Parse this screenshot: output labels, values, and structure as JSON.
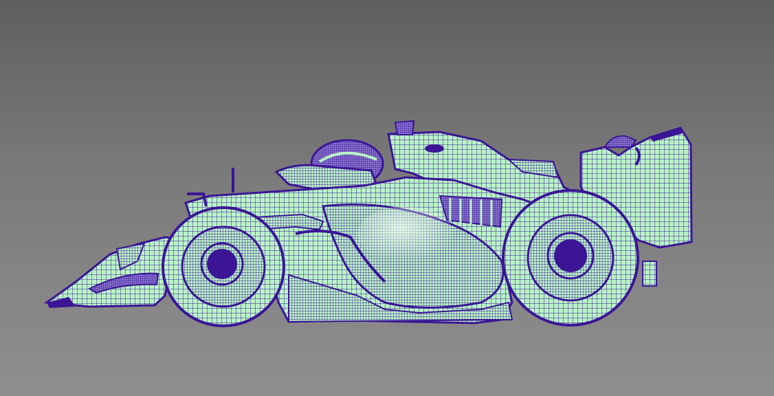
{
  "viewport": {
    "background_top": "#5f5f5f",
    "background_bottom": "#8f8f8f"
  },
  "model": {
    "object": "formula-car-wireframe-mesh",
    "surface_color": "#b9f3c6",
    "wire_color": "#3b1596",
    "highlight_color": "#eefaf0"
  }
}
